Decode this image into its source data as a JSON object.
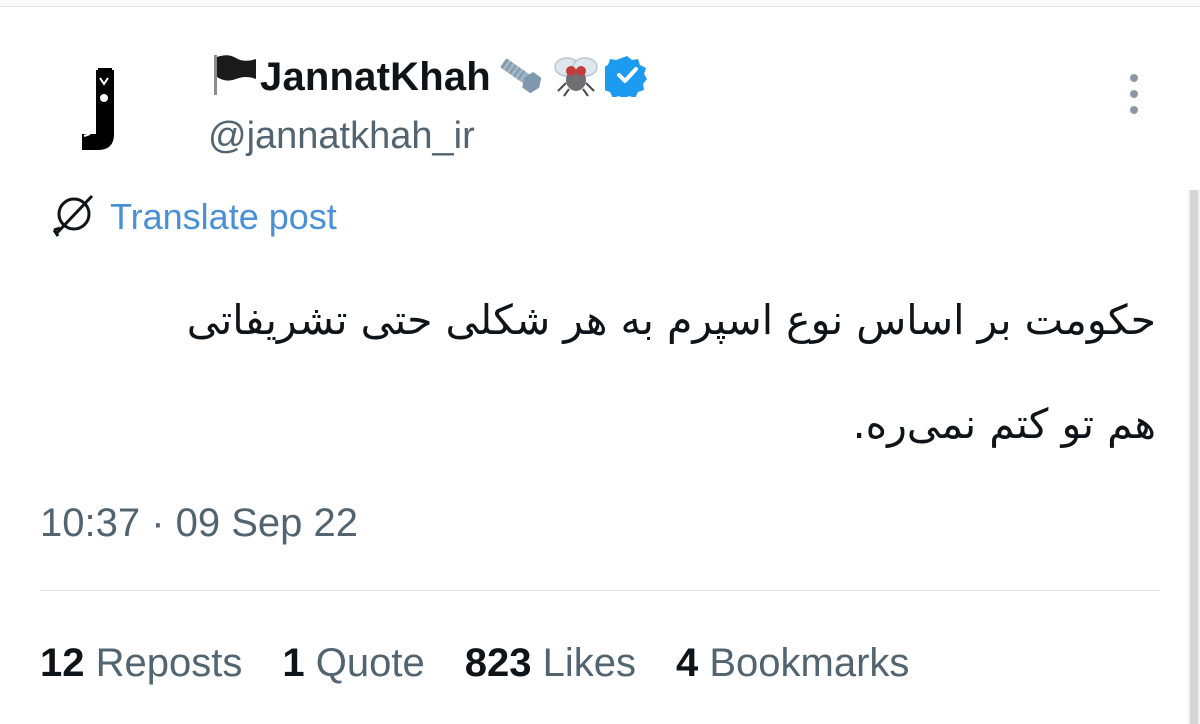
{
  "author": {
    "display_name": "JannatKhah",
    "handle": "@jannatkhah_ir",
    "verified": true,
    "avatar_letter": "J",
    "name_emojis": [
      "black-flag-icon",
      "nut-and-bolt-icon",
      "fly-icon"
    ]
  },
  "translate": {
    "label": "Translate post"
  },
  "post": {
    "text": "حکومت بر اساس نوع اسپرم به هر شکلی حتی تشریفاتی هم تو کتم نمی‌ره."
  },
  "meta": {
    "timestamp": "10:37 · 09 Sep 22"
  },
  "stats": {
    "reposts": {
      "count": "12",
      "label": "Reposts"
    },
    "quotes": {
      "count": "1",
      "label": "Quote"
    },
    "likes": {
      "count": "823",
      "label": "Likes"
    },
    "bookmarks": {
      "count": "4",
      "label": "Bookmarks"
    }
  },
  "colors": {
    "link": "#4a90d6",
    "verified": "#1d9bf0",
    "secondary_text": "#536471",
    "primary_text": "#0f1419"
  }
}
